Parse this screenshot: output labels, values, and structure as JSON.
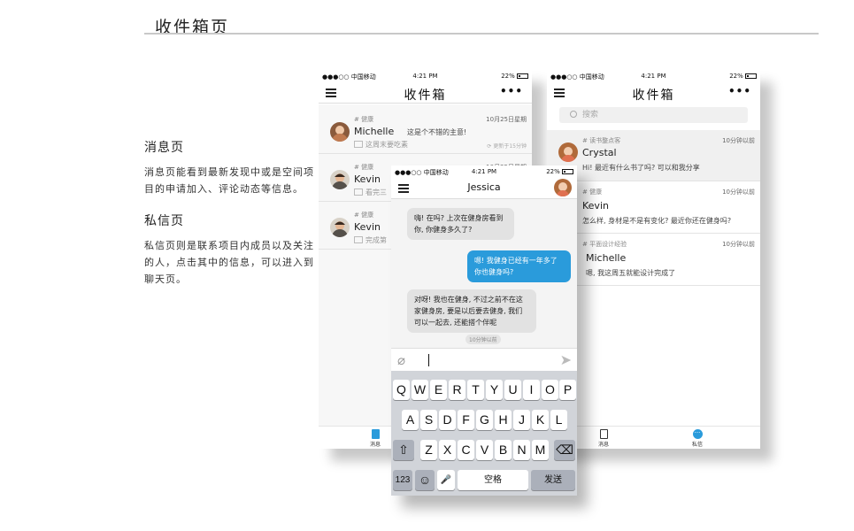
{
  "page": {
    "title": "收件箱页",
    "sections": [
      {
        "heading": "消息页",
        "body": "消息页能看到最新发现中或是空间项目的申请加入、评论动态等信息。"
      },
      {
        "heading": "私信页",
        "body": "私信页则是联系项目内成员以及关注的人，点击其中的信息，可以进入到聊天页。"
      }
    ]
  },
  "status_bar": {
    "carrier": "●●●○○ 中国移动",
    "time": "4:21 PM",
    "battery": "22%"
  },
  "inbox_messages": {
    "nav_title": "收件箱",
    "more": "•••",
    "rows": [
      {
        "tag": "# 健康",
        "time": "10月25日星期",
        "name": "Michelle",
        "msg": "这是个不错的主意!",
        "sub": "这周末要吃素",
        "synced": "更新于15分钟"
      },
      {
        "tag": "# 健康",
        "time": "10月25日星期",
        "name": "Kevin",
        "msg": "",
        "sub": "看完三",
        "synced": ""
      },
      {
        "tag": "# 健康",
        "time": "",
        "name": "Kevin",
        "msg": "",
        "sub": "完成第",
        "synced": ""
      }
    ],
    "tabs": [
      {
        "label": "消息"
      },
      {
        "label": "私信"
      }
    ]
  },
  "inbox_private": {
    "nav_title": "收件箱",
    "more": "•••",
    "search_placeholder": "搜索",
    "rows": [
      {
        "tag": "# 读书整点客",
        "time": "10分钟以前",
        "name": "Crystal",
        "msg": "Hi! 最近有什么书了吗? 可以和我分享"
      },
      {
        "tag": "# 健康",
        "time": "10分钟以前",
        "name": "Kevin",
        "msg": "怎么样, 身材是不是有变化? 最近你还在健身吗?"
      },
      {
        "tag": "# 平面设计经验",
        "time": "10分钟以前",
        "name": "Michelle",
        "msg": "嗯, 我这周五就能设计完成了"
      }
    ],
    "tabs": [
      {
        "label": "消息"
      },
      {
        "label": "私信"
      }
    ]
  },
  "chat": {
    "contact": "Jessica",
    "messages": [
      {
        "dir": "in",
        "text": "嗨! 在吗? 上次在健身房看到你, 你健身多久了?"
      },
      {
        "dir": "out",
        "text": "嗯! 我健身已经有一年多了你也健身吗?"
      },
      {
        "dir": "in",
        "text": "对呀! 我也在健身, 不过之前不在这家健身房, 要是以后要去健身, 我们可以一起去, 还能搭个伴呢"
      }
    ],
    "stamp": "10分钟以前",
    "keyboard": {
      "row1": [
        "Q",
        "W",
        "E",
        "R",
        "T",
        "Y",
        "U",
        "I",
        "O",
        "P"
      ],
      "row2": [
        "A",
        "S",
        "D",
        "F",
        "G",
        "H",
        "J",
        "K",
        "L"
      ],
      "row3": [
        "Z",
        "X",
        "C",
        "V",
        "B",
        "N",
        "M"
      ],
      "num": "123",
      "emoji": "☺",
      "mic": "🎤",
      "space": "空格",
      "send": "发送",
      "shift": "⇧",
      "backspace": "⌫"
    }
  },
  "colors": {
    "accent": "#2a9bdb",
    "bubble_in": "#e2e2e2",
    "keyboard": "#d1d4d9"
  }
}
